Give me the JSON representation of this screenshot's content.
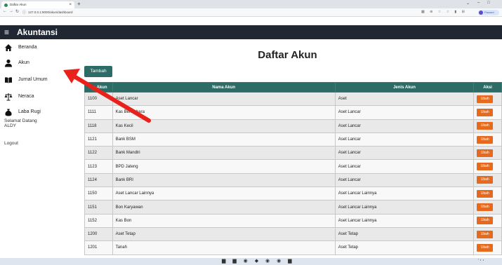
{
  "browser": {
    "tab_title": "Daftar Akun",
    "tab_close": "×",
    "new_tab": "+",
    "url": "127.0.0.1:8000/akun/dashboard",
    "profile_status": "Paused",
    "win_minimize": "–",
    "win_maximize": "□",
    "win_chevron": "⌄"
  },
  "app": {
    "brand": "Akuntansi"
  },
  "sidebar": {
    "items": [
      {
        "label": "Beranda",
        "icon": "home-icon"
      },
      {
        "label": "Akun",
        "icon": "user-icon"
      },
      {
        "label": "Jurnal Umum",
        "icon": "book-icon"
      },
      {
        "label": "Neraca",
        "icon": "scale-icon"
      },
      {
        "label": "Laba Rugi",
        "icon": "money-bag-icon"
      }
    ],
    "welcome_line1": "Selamat Datang",
    "welcome_line2": "ALDY",
    "logout": "Logout"
  },
  "main": {
    "title": "Daftar Akun",
    "add_button": "Tambah",
    "table": {
      "headers": [
        "No Akun",
        "Nama Akun",
        "Jenis Akun",
        "Aksi"
      ],
      "action_label": "Ubah",
      "rows": [
        [
          "1100",
          "Aset Lancar",
          "Aset"
        ],
        [
          "1111",
          "Kas Bendahara",
          "Aset Lancar"
        ],
        [
          "1118",
          "Kas Kecil",
          "Aset Lancar"
        ],
        [
          "1121",
          "Bank BSM",
          "Aset Lancar"
        ],
        [
          "1122",
          "Bank Mandiri",
          "Aset Lancar"
        ],
        [
          "1123",
          "BPD Jateng",
          "Aset Lancar"
        ],
        [
          "1124",
          "Bank BRI",
          "Aset Lancar"
        ],
        [
          "1150",
          "Aset Lancar Lainnya",
          "Aset Lancar Lainnya"
        ],
        [
          "1151",
          "Bon Karyawan",
          "Aset Lancar Lainnya"
        ],
        [
          "1152",
          "Kas Bon",
          "Aset Lancar Lainnya"
        ],
        [
          "1200",
          "Aset Tetap",
          "Aset Tetap"
        ],
        [
          "1201",
          "Tanah",
          "Aset Tetap"
        ]
      ]
    }
  },
  "colors": {
    "topbar": "#202733",
    "accent": "#2d6b66",
    "action": "#e66a1d",
    "annotation_arrow": "#e8221b"
  }
}
